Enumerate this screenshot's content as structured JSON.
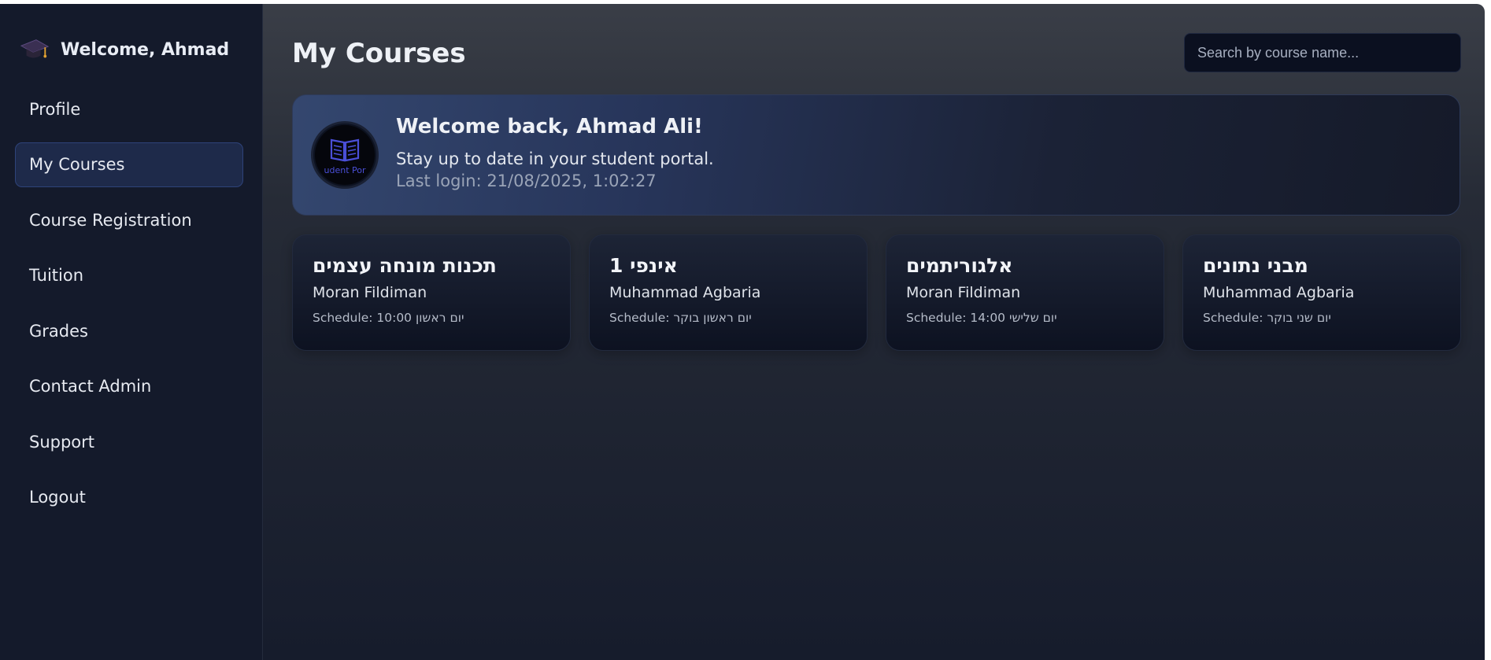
{
  "sidebar": {
    "brand_title": "Welcome, Ahmad",
    "items": [
      {
        "label": "Profile"
      },
      {
        "label": "My Courses"
      },
      {
        "label": "Course Registration"
      },
      {
        "label": "Tuition"
      },
      {
        "label": "Grades"
      },
      {
        "label": "Contact Admin"
      },
      {
        "label": "Support"
      },
      {
        "label": "Logout"
      }
    ],
    "active_index": 1
  },
  "header": {
    "title": "My Courses",
    "search_placeholder": "Search by course name...",
    "search_value": ""
  },
  "welcome": {
    "title": "Welcome back, Ahmad Ali!",
    "subtitle": "Stay up to date in your student portal.",
    "last_login": "Last login: 21/08/2025, 1:02:27",
    "logo_text": "udent Por"
  },
  "courses": [
    {
      "name": "תכנות מונחה עצמים",
      "teacher": "Moran Fildiman",
      "schedule": "Schedule: 10:00 יום ראשון"
    },
    {
      "name": "אינפי 1",
      "teacher": "Muhammad Agbaria",
      "schedule": "Schedule: יום ראשון בוקר"
    },
    {
      "name": "אלגוריתמים",
      "teacher": "Moran Fildiman",
      "schedule": "Schedule: 14:00 יום שלישי"
    },
    {
      "name": "מבני נתונים",
      "teacher": "Muhammad Agbaria",
      "schedule": "Schedule: יום שני בוקר"
    }
  ],
  "colors": {
    "sidebar_bg": "#141a2b",
    "active_item_bg": "#1e2a4a",
    "active_item_border": "#2e437a",
    "logo_accent": "#4a4fd8"
  },
  "icons": {
    "brand": "graduation-cap-icon",
    "avatar": "open-book-icon"
  }
}
